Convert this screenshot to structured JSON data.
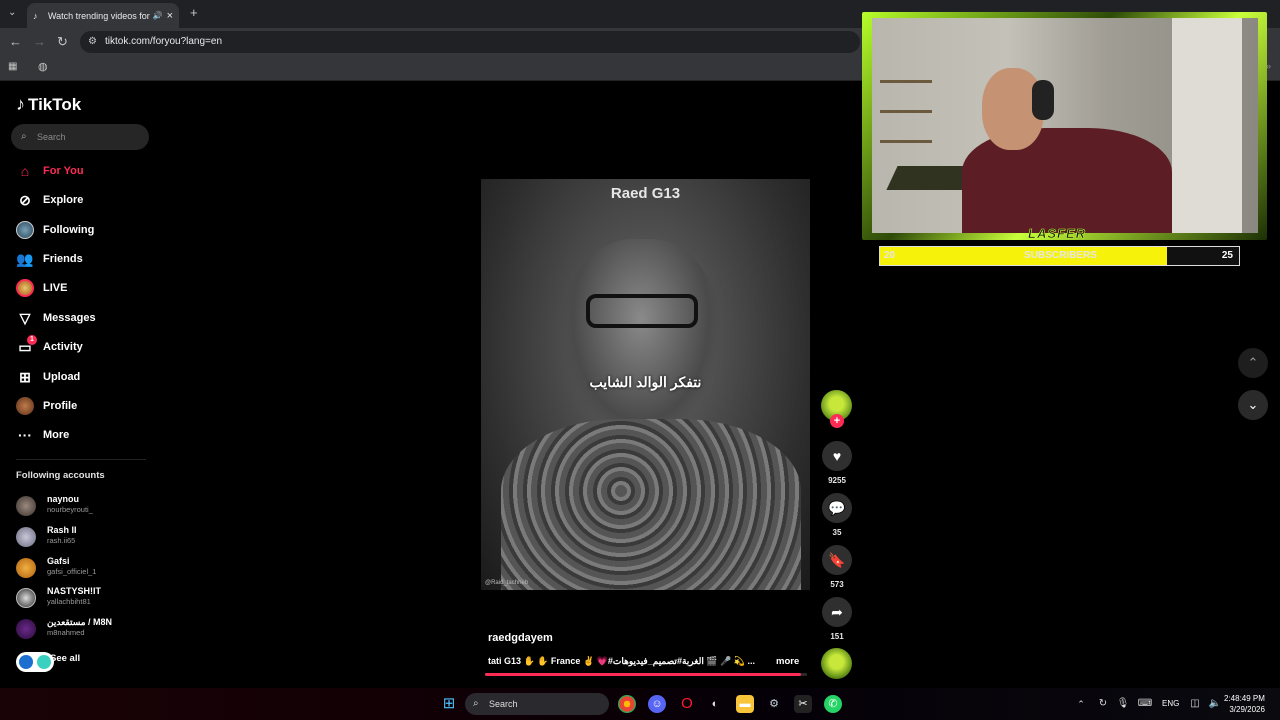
{
  "browser": {
    "tab_title": "Watch trending videos for y",
    "url": "tiktok.com/foryou?lang=en",
    "new_tab_glyph": "+",
    "close_glyph": "×"
  },
  "tiktok": {
    "logo_text": "TikTok",
    "search_placeholder": "Search",
    "nav": [
      {
        "label": "For You",
        "icon": "home-icon"
      },
      {
        "label": "Explore",
        "icon": "compass-icon"
      },
      {
        "label": "Following",
        "icon": "following-avatar-icon"
      },
      {
        "label": "Friends",
        "icon": "friends-icon"
      },
      {
        "label": "LIVE",
        "icon": "live-icon"
      },
      {
        "label": "Messages",
        "icon": "paper-plane-icon"
      },
      {
        "label": "Activity",
        "icon": "activity-icon",
        "badge": "1"
      },
      {
        "label": "Upload",
        "icon": "upload-plus-icon"
      },
      {
        "label": "Profile",
        "icon": "profile-avatar-icon"
      },
      {
        "label": "More",
        "icon": "more-dots-icon"
      }
    ],
    "following_title": "Following accounts",
    "accounts": [
      {
        "name": "naynou",
        "handle": "nourbeyrouti_"
      },
      {
        "name": "Rash II",
        "handle": "rash.ii65"
      },
      {
        "name": "Gafsi",
        "handle": "gafsi_officiel_1"
      },
      {
        "name": "NASTYSH!IT",
        "handle": "yallachbiht81"
      },
      {
        "name": "مستقعدين / M8N",
        "handle": "m8nahmed"
      }
    ],
    "see_all": "See all"
  },
  "video": {
    "overlay_title": "Raed G13",
    "subtitle": "نتفكر الوالد الشايب",
    "watermark": "@Raid_tachheb",
    "author": "raedgdayem",
    "caption": "tati G13 ✋ ✋ France ✌️ 💗#الغربة#تصميم_فيديوهات 🎬 🎤 💫 ...",
    "more": "more",
    "progress": 0.98
  },
  "actions": {
    "follow_plus": "+",
    "likes": "9255",
    "comments": "35",
    "saves": "573",
    "shares": "151"
  },
  "stream_overlay": {
    "logo": "LASFER",
    "subs_current": "20",
    "subs_label": "SUBSCRIBERS",
    "subs_goal": "25",
    "subs_progress": 0.8
  },
  "taskbar": {
    "search": "Search",
    "lang": "ENG",
    "time": "2:48:49 PM",
    "date": "3/29/2026"
  },
  "colors": {
    "accent": "#fe2c55",
    "subs_fill": "#f7f20a",
    "overlay_green": "#b7ff2a"
  }
}
